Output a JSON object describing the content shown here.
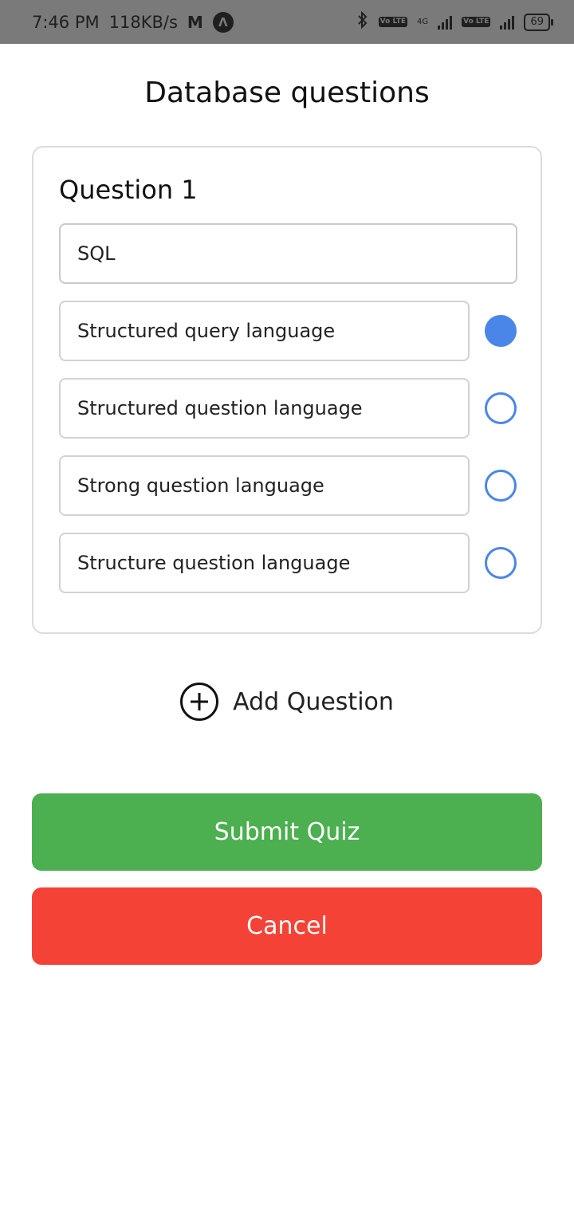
{
  "status_bar": {
    "time": "7:46 PM",
    "speed": "118KB/s",
    "mail_icon": "M",
    "nav_icon": "Λ",
    "volte1": "Vo LTE",
    "network": "4G",
    "volte2": "Vo LTE",
    "battery": "69"
  },
  "page": {
    "title": "Database questions"
  },
  "question": {
    "label": "Question 1",
    "text": "SQL",
    "options": [
      {
        "label": "Structured query language",
        "selected": true
      },
      {
        "label": "Structured question language",
        "selected": false
      },
      {
        "label": "Strong question language",
        "selected": false
      },
      {
        "label": "Structure question language",
        "selected": false
      }
    ]
  },
  "actions": {
    "add_question": "Add Question",
    "submit": "Submit Quiz",
    "cancel": "Cancel"
  },
  "colors": {
    "accent_blue": "#4a86e8",
    "submit_green": "#4caf50",
    "cancel_red": "#f44336"
  }
}
